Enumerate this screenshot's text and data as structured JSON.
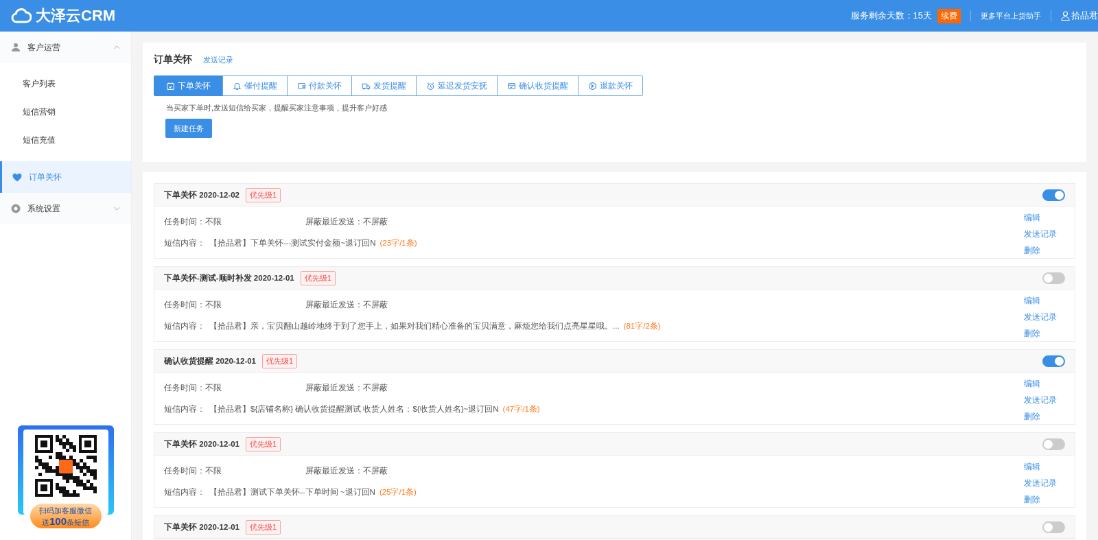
{
  "header": {
    "logo": "大泽云CRM",
    "service_days": "服务剩余天数：15天",
    "renew": "续费",
    "more_platforms": "更多平台上货助手",
    "user": "拾品君"
  },
  "sidebar": {
    "items": [
      {
        "label": "客户运营",
        "kind": "group",
        "expanded": true,
        "selected": false,
        "children": [
          {
            "label": "客户列表",
            "selected": false
          },
          {
            "label": "短信营销",
            "selected": false
          },
          {
            "label": "短信充值",
            "selected": false
          }
        ]
      },
      {
        "label": "订单关怀",
        "kind": "item",
        "selected": true
      },
      {
        "label": "系统设置",
        "kind": "group",
        "expanded": false,
        "selected": false
      }
    ],
    "promo": {
      "line1": "扫码加客服微信",
      "line2": "送**100**条短信"
    }
  },
  "page": {
    "title": "订单关怀",
    "send_log_link": "发送记录",
    "tabs": [
      {
        "label": "下单关怀",
        "selected": true
      },
      {
        "label": "催付提醒",
        "selected": false
      },
      {
        "label": "付款关怀",
        "selected": false
      },
      {
        "label": "发货提醒",
        "selected": false
      },
      {
        "label": "延迟发货安抚",
        "selected": false
      },
      {
        "label": "确认收货提醒",
        "selected": false
      },
      {
        "label": "退款关怀",
        "selected": false
      }
    ],
    "description": "当买家下单时,发送短信给买家，提醒买家注意事项，提升客户好感",
    "new_task_button": "新建任务"
  },
  "tasks": [
    {
      "title": "下单关怀 2020-12-02",
      "priority": "优先级1",
      "on": true,
      "task_time": "任务时间：不限",
      "block_recent": "屏蔽最近发送：不屏蔽",
      "sms_label": "短信内容：",
      "sms": "【拾品君】下单关怀---测试实付金额~退订回N",
      "sms_count": "(23字/1条)",
      "actions": [
        "编辑",
        "发送记录",
        "删除"
      ]
    },
    {
      "title": "下单关怀-测试-顺时补发 2020-12-01",
      "priority": "优先级1",
      "on": false,
      "task_time": "任务时间：不限",
      "block_recent": "屏蔽最近发送：不屏蔽",
      "sms_label": "短信内容：",
      "sms": "【拾品君】亲，宝贝翻山越岭地终于到了您手上，如果对我们精心准备的宝贝满意，麻烦您给我们点亮星星哦。...",
      "sms_count": "(81字/2条)",
      "actions": [
        "编辑",
        "发送记录",
        "删除"
      ]
    },
    {
      "title": "确认收货提醒 2020-12-01",
      "priority": "优先级1",
      "on": true,
      "task_time": "任务时间：不限",
      "block_recent": "屏蔽最近发送：不屏蔽",
      "sms_label": "短信内容：",
      "sms": "【拾品君】${店铺名称} 确认收货提醒测试 收货人姓名：${收货人姓名}~退订回N",
      "sms_count": "(47字/1条)",
      "actions": [
        "编辑",
        "发送记录",
        "删除"
      ]
    },
    {
      "title": "下单关怀 2020-12-01",
      "priority": "优先级1",
      "on": false,
      "task_time": "任务时间：不限",
      "block_recent": "屏蔽最近发送：不屏蔽",
      "sms_label": "短信内容：",
      "sms": "【拾品君】测试下单关怀--下单时间 ~退订回N",
      "sms_count": "(25字/1条)",
      "actions": [
        "编辑",
        "发送记录",
        "删除"
      ]
    },
    {
      "title": "下单关怀 2020-12-01",
      "priority": "优先级1",
      "on": false
    }
  ]
}
